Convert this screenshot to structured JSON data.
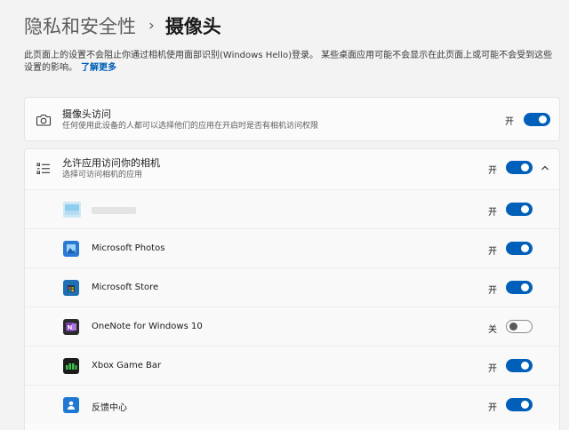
{
  "header": {
    "parent": "隐私和安全性",
    "separator": "›",
    "current": "摄像头"
  },
  "description": {
    "text": "此页面上的设置不会阻止你通过相机使用面部识别(Windows Hello)登录。 某些桌面应用可能不会显示在此页面上或可能不会受到这些设置的影响。",
    "link": "了解更多"
  },
  "camera_access": {
    "title": "摄像头访问",
    "subtitle": "任何使用此设备的人都可以选择他们的应用在开启时是否有相机访问权限",
    "state": "开",
    "on": true
  },
  "app_access": {
    "title": "允许应用访问你的相机",
    "subtitle": "选择可访问相机的应用",
    "state": "开",
    "on": true,
    "expanded": true
  },
  "apps": [
    {
      "name": "",
      "state": "开",
      "on": true,
      "icon": "blurred-app-icon",
      "color": "#6ec1ea"
    },
    {
      "name": "Microsoft Photos",
      "state": "开",
      "on": true,
      "icon": "photos-icon",
      "color": "#2a7ad5"
    },
    {
      "name": "Microsoft Store",
      "state": "开",
      "on": true,
      "icon": "store-icon",
      "color": "#1f6fb5"
    },
    {
      "name": "OneNote for Windows 10",
      "state": "关",
      "on": false,
      "icon": "onenote-icon",
      "color": "#7b3fb1"
    },
    {
      "name": "Xbox Game Bar",
      "state": "开",
      "on": true,
      "icon": "xbox-game-bar-icon",
      "color": "#1a7f37"
    },
    {
      "name": "反馈中心",
      "state": "开",
      "on": true,
      "icon": "feedback-hub-icon",
      "color": "#1f78d1"
    }
  ],
  "colors": {
    "accent": "#005fb8",
    "page_bg": "#f3f3f3",
    "card_bg": "#fbfbfb"
  }
}
